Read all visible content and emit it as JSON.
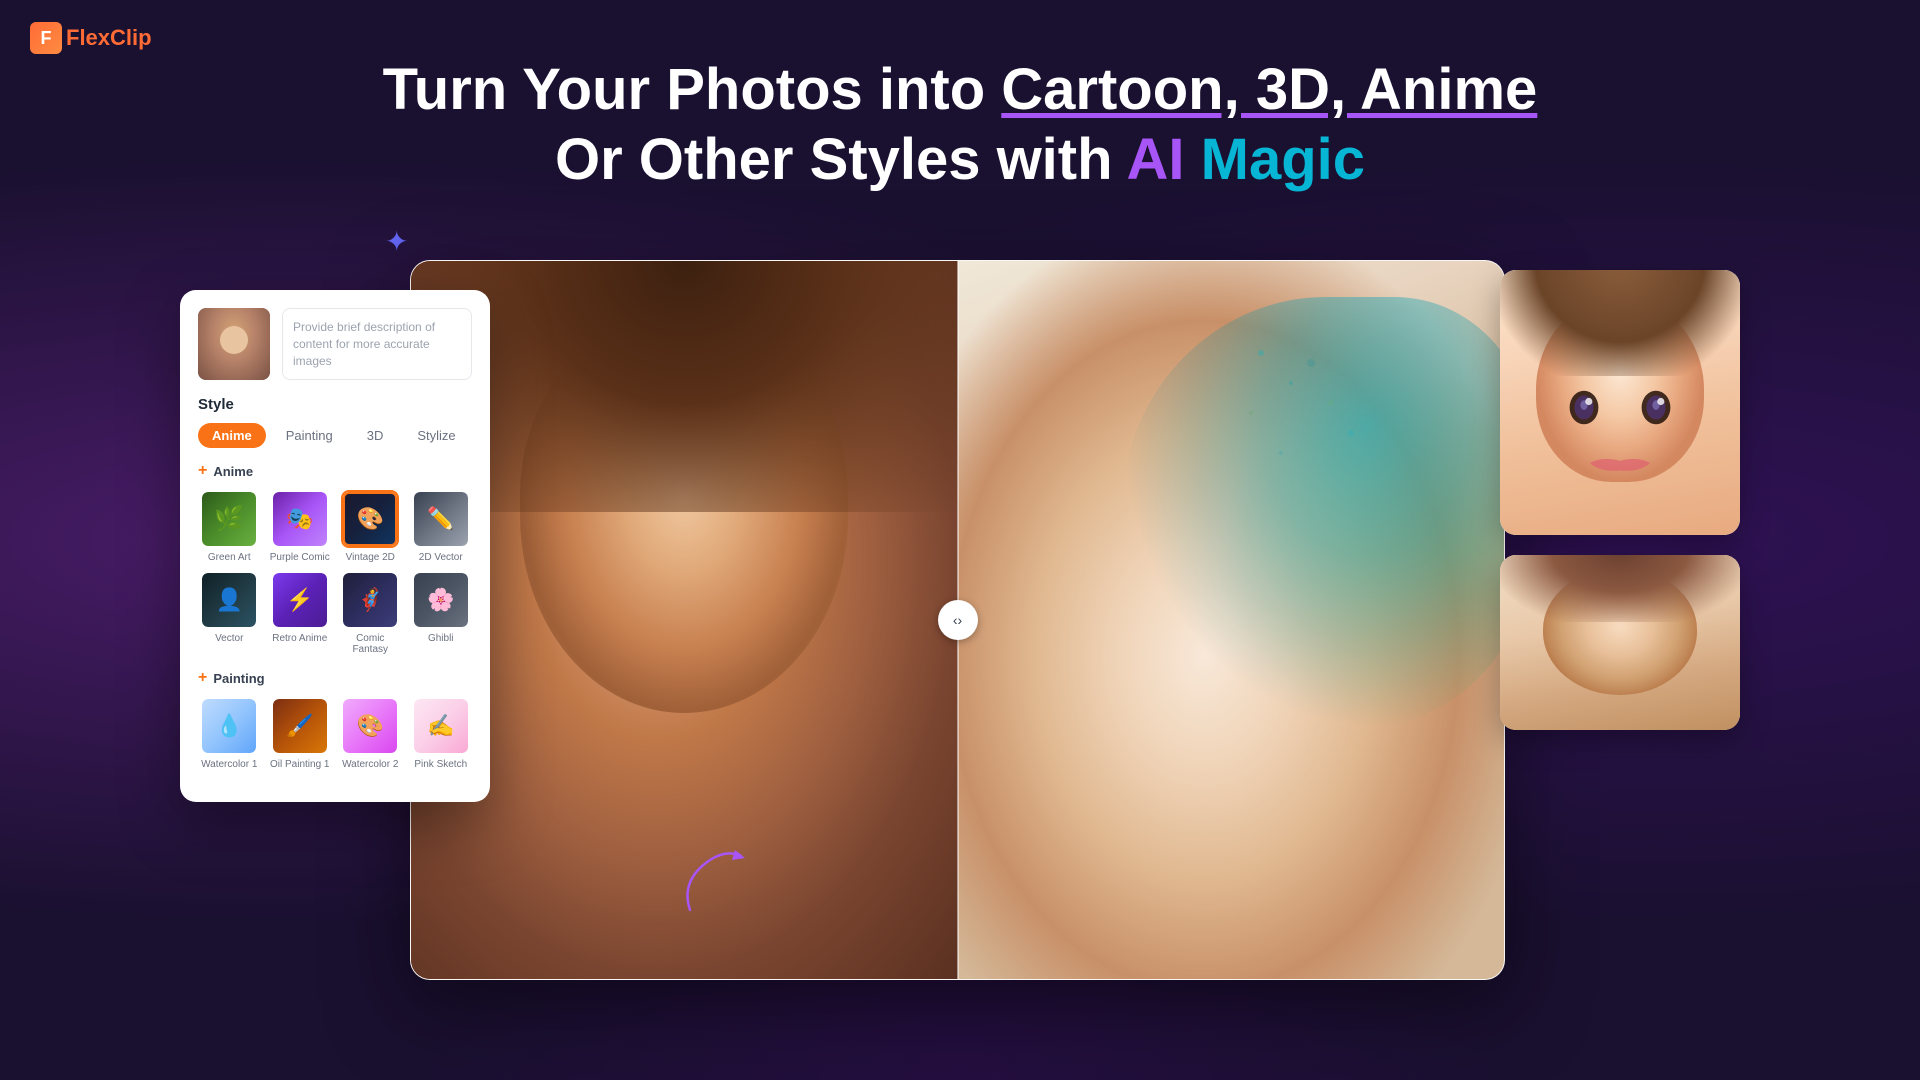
{
  "logo": {
    "icon": "F",
    "name": "FlexClip"
  },
  "header": {
    "line1": "Turn Your Photos into Cartoon, 3D, Anime",
    "line1_cartoon": "Cartoon, 3D, Anime",
    "line2_prefix": "Or Other Styles with ",
    "ai": "AI",
    "magic": "Magic"
  },
  "panel": {
    "description_placeholder": "Provide brief description of content for more accurate images",
    "style_label": "Style",
    "tabs": [
      {
        "label": "Anime",
        "active": true
      },
      {
        "label": "Painting",
        "active": false
      },
      {
        "label": "3D",
        "active": false
      },
      {
        "label": "Stylize",
        "active": false
      }
    ],
    "anime_section": {
      "label": "Anime",
      "items": [
        {
          "name": "Green Art",
          "class": "thumb-green-art"
        },
        {
          "name": "Purple Comic",
          "class": "thumb-purple-comic"
        },
        {
          "name": "Vintage 2D",
          "class": "thumb-vintage-2d",
          "selected": true
        },
        {
          "name": "2D Vector",
          "class": "thumb-2d-vector"
        },
        {
          "name": "Vector",
          "class": "thumb-vector"
        },
        {
          "name": "Retro Anime",
          "class": "thumb-retro-anime"
        },
        {
          "name": "Comic Fantasy",
          "class": "thumb-comic-fantasy"
        },
        {
          "name": "Ghibli",
          "class": "thumb-ghibli"
        }
      ]
    },
    "painting_section": {
      "label": "Painting",
      "items": [
        {
          "name": "Watercolor 1",
          "class": "thumb-watercolor1"
        },
        {
          "name": "Oil Painting 1",
          "class": "thumb-oil-painting1"
        },
        {
          "name": "Watercolor 2",
          "class": "thumb-watercolor2"
        },
        {
          "name": "Pink Sketch",
          "class": "thumb-pink-sketch"
        }
      ]
    }
  },
  "slider": {
    "handle_icon": "‹›"
  },
  "icons": {
    "sparkle": "✦",
    "plus": "+"
  }
}
